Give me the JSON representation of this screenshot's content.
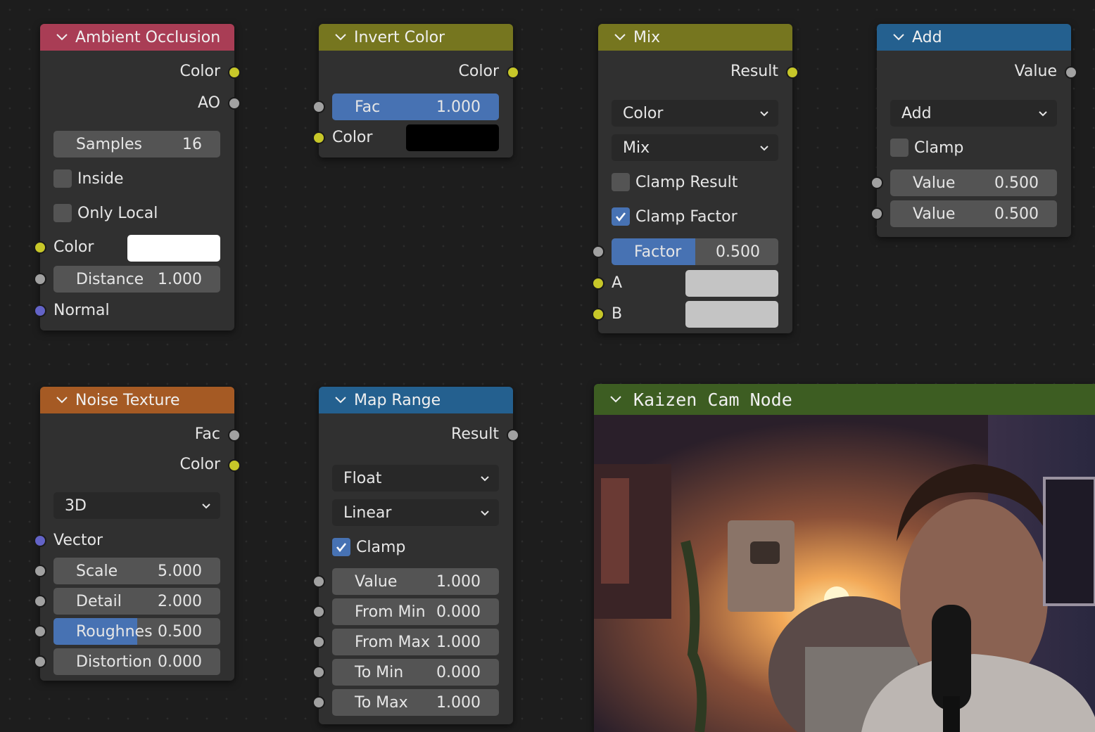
{
  "colors": {
    "ao_header": "#a93d55",
    "invert_header": "#76761f",
    "mix_header": "#76761f",
    "add_header": "#24608f",
    "noise_header": "#a55a24",
    "maprange_header": "#24608f",
    "cam_header": "#3d5d22",
    "socket_yellow": "#c7c729",
    "socket_grey": "#a1a1a1",
    "socket_purple": "#6363c7",
    "field_fill": "#4772b3"
  },
  "ambient_occlusion": {
    "title": "Ambient Occlusion",
    "out_color": "Color",
    "out_ao": "AO",
    "samples_label": "Samples",
    "samples_value": "16",
    "inside_label": "Inside",
    "only_local_label": "Only Local",
    "color_label": "Color",
    "distance_label": "Distance",
    "distance_value": "1.000",
    "normal_label": "Normal"
  },
  "invert_color": {
    "title": "Invert Color",
    "out_color": "Color",
    "fac_label": "Fac",
    "fac_value": "1.000",
    "fac_fraction": 1.0,
    "color_label": "Color"
  },
  "mix": {
    "title": "Mix",
    "out_result": "Result",
    "data_type": "Color",
    "blend_mode": "Mix",
    "clamp_result_label": "Clamp Result",
    "clamp_factor_label": "Clamp Factor",
    "factor_label": "Factor",
    "factor_value": "0.500",
    "factor_fraction": 0.5,
    "a_label": "A",
    "b_label": "B"
  },
  "add": {
    "title": "Add",
    "out_value": "Value",
    "operation": "Add",
    "clamp_label": "Clamp",
    "value1_label": "Value",
    "value1": "0.500",
    "value2_label": "Value",
    "value2": "0.500"
  },
  "noise_texture": {
    "title": "Noise Texture",
    "out_fac": "Fac",
    "out_color": "Color",
    "dimensions": "3D",
    "vector_label": "Vector",
    "scale_label": "Scale",
    "scale_value": "5.000",
    "detail_label": "Detail",
    "detail_value": "2.000",
    "roughness_label": "Roughnes",
    "roughness_value": "0.500",
    "roughness_fraction": 0.5,
    "distortion_label": "Distortion",
    "distortion_value": "0.000"
  },
  "map_range": {
    "title": "Map Range",
    "out_result": "Result",
    "data_type": "Float",
    "interpolation": "Linear",
    "clamp_label": "Clamp",
    "value_label": "Value",
    "value": "1.000",
    "from_min_label": "From Min",
    "from_min": "0.000",
    "from_max_label": "From Max",
    "from_max": "1.000",
    "to_min_label": "To Min",
    "to_min": "0.000",
    "to_max_label": "To Max",
    "to_max": "1.000"
  },
  "cam_node": {
    "title": "Kaizen Cam Node"
  }
}
